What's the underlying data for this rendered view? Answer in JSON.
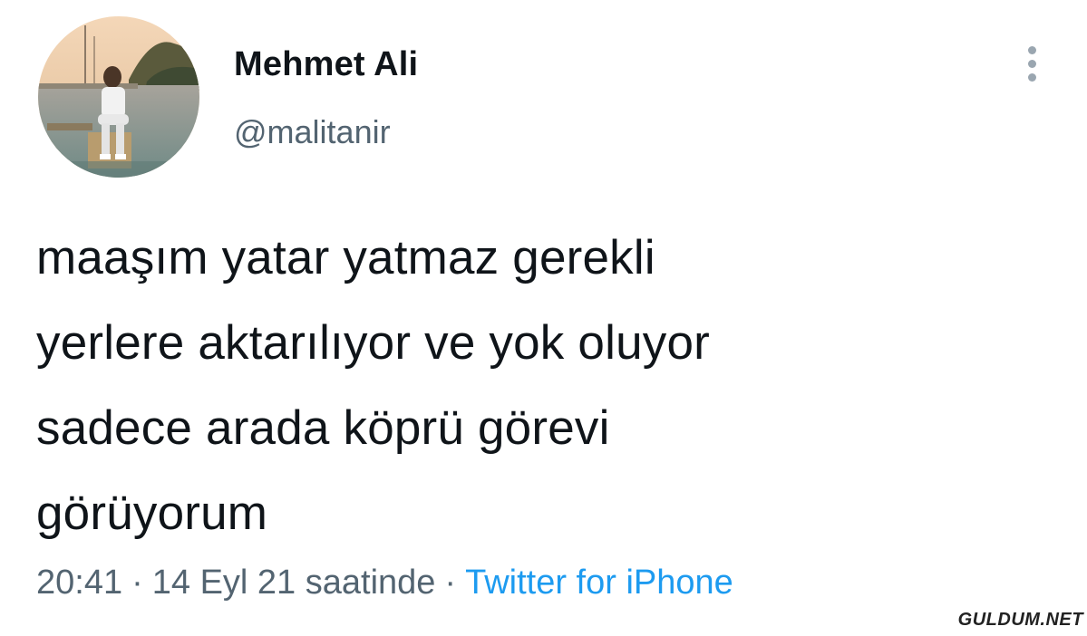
{
  "user": {
    "display_name": "Mehmet Ali",
    "handle": "@malitanir"
  },
  "tweet": {
    "text_lines": [
      "maaşım yatar yatmaz gerekli",
      "yerlere aktarılıyor ve yok oluyor",
      "sadece arada köprü görevi",
      "görüyorum"
    ],
    "time": "20:41",
    "date": "14 Eyl 21 saatinde",
    "source": "Twitter for iPhone"
  },
  "menu": {
    "icon": "more-vertical-icon"
  },
  "watermark": "GULDUM.NET",
  "colors": {
    "text": "#0f1419",
    "secondary": "#536471",
    "link": "#1d9bf0"
  }
}
